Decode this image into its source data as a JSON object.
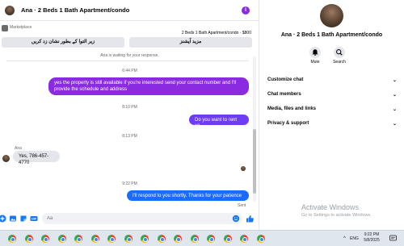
{
  "header": {
    "title": "Ana · 2 Beds 1 Bath Apartment/condo",
    "info_icon": "info-icon",
    "info_glyph": "i"
  },
  "listing": {
    "source": "Marketplace",
    "detail": "2 Beds 1 Bath Apartment/condo · $800"
  },
  "quick_actions": {
    "left_label": "زیر التوا کے بطور نشان زد کریں",
    "right_label": "مزید آپشنز"
  },
  "waiting_text": "Ana is waiting for your response.",
  "messages": [
    {
      "time": "6:44 PM",
      "sender": "me",
      "text": "yes the property is still available if you're interested send your contact number and I'll provide the schedule and address"
    },
    {
      "time": "8:10 PM",
      "sender": "me",
      "text": "Do you want to rent it?"
    },
    {
      "time": "8:13 PM",
      "sender": "Ana",
      "name": "Ana",
      "text": "Yes, 786-457-4770"
    },
    {
      "time": "9:22 PM",
      "sender": "me",
      "text": "I'll respond to you shortly. Thanks for your patience",
      "status": "Sent"
    }
  ],
  "composer": {
    "placeholder": "Aa",
    "icons": [
      "plus-icon",
      "image-icon",
      "sticker-icon",
      "gif-icon",
      "emoji-icon",
      "like-icon"
    ]
  },
  "info_panel": {
    "title": "Ana · 2 Beds 1 Bath Apartment/condo",
    "actions": {
      "mute": "Mute",
      "search": "Search"
    },
    "sections": [
      "Customize chat",
      "Chat members",
      "Media, files and links",
      "Privacy & support"
    ]
  },
  "watermark": {
    "title": "Activate Windows",
    "subtitle": "Go to Settings to activate Windows."
  },
  "taskbar": {
    "app_icon": "chrome-icon",
    "app_count": 16,
    "time": "9:22 PM",
    "date": "5/8/2025",
    "tray": {
      "chevron": "^",
      "lang": "ENG"
    }
  },
  "colors": {
    "accent_purple": "#8a2be2",
    "accent_blue": "#1a6cff",
    "incoming_bg": "#e4e6eb"
  }
}
